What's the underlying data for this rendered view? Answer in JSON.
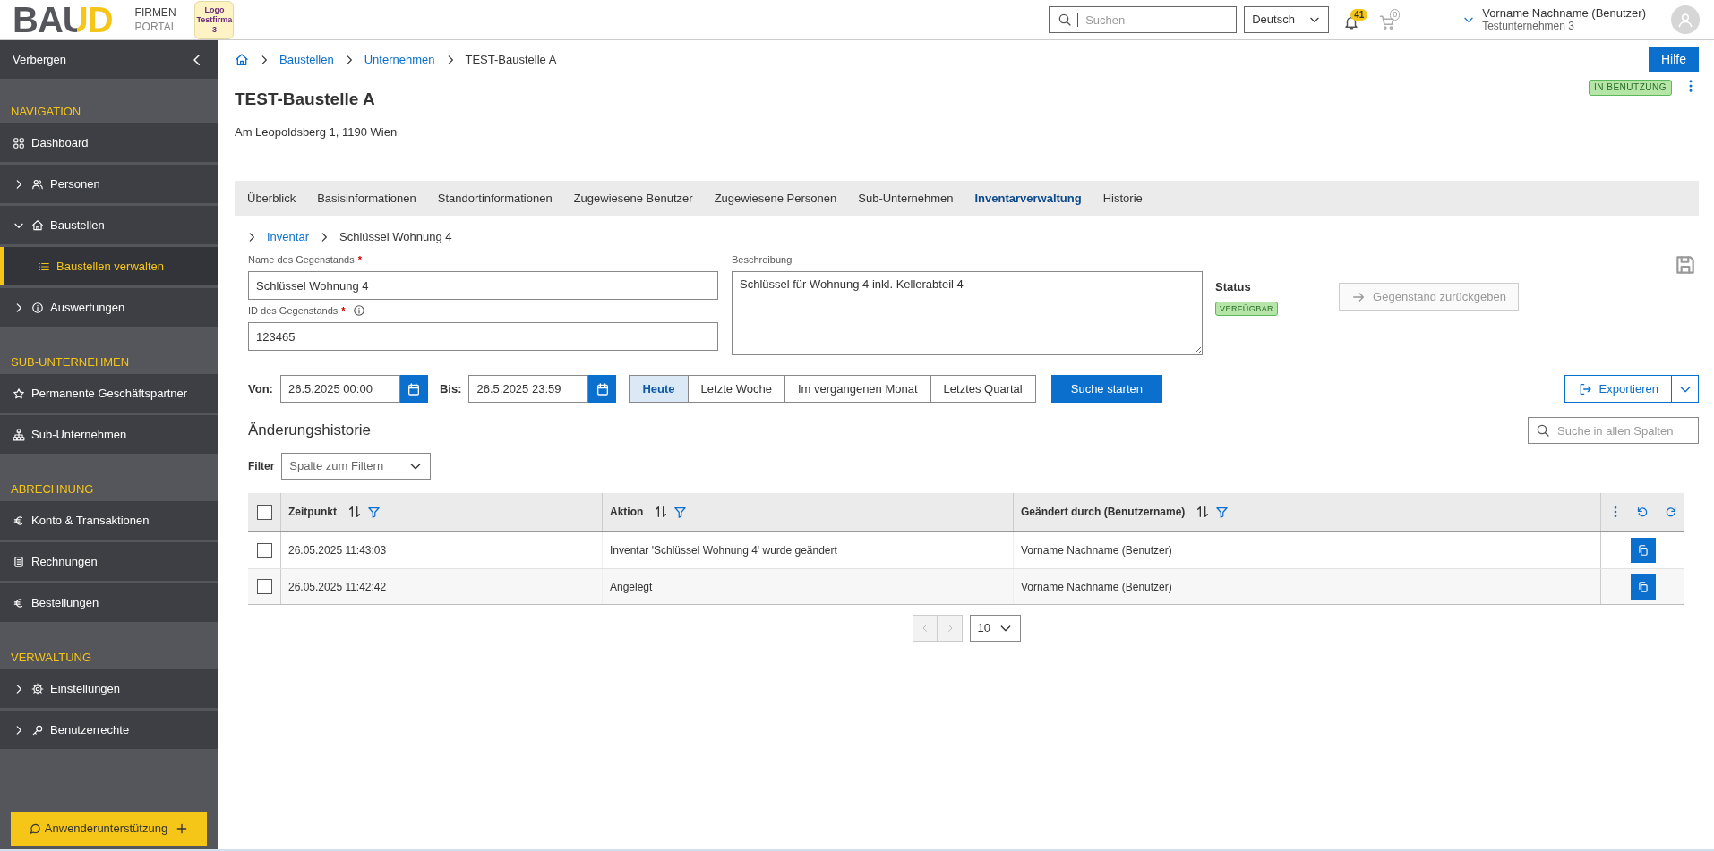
{
  "header": {
    "logo": "BAUD",
    "portal_line1": "FIRMEN",
    "portal_line2": "PORTAL",
    "company_logo": "Logo Testfirma 3",
    "search": {
      "placeholder": "Suchen"
    },
    "language": "Deutsch",
    "notifications": "41",
    "cart": "0",
    "user": {
      "name": "Vorname Nachname (Benutzer)",
      "company": "Testunternehmen 3"
    }
  },
  "sidebar": {
    "hide_label": "Verbergen",
    "sections": [
      {
        "title": "NAVIGATION",
        "items": [
          {
            "label": "Dashboard",
            "kind": "link",
            "selected": false
          },
          {
            "label": "Personen",
            "kind": "group",
            "expanded": false,
            "selected": false
          },
          {
            "label": "Baustellen",
            "kind": "group",
            "expanded": true,
            "selected": false,
            "children": [
              {
                "label": "Baustellen verwalten",
                "selected": true
              }
            ]
          },
          {
            "label": "Auswertungen",
            "kind": "group",
            "expanded": false,
            "selected": false
          }
        ]
      },
      {
        "title": "SUB-UNTERNEHMEN",
        "items": [
          {
            "label": "Permanente Geschäftspartner",
            "kind": "link",
            "selected": false
          },
          {
            "label": "Sub-Unternehmen",
            "kind": "link",
            "selected": false
          }
        ]
      },
      {
        "title": "ABRECHNUNG",
        "items": [
          {
            "label": "Konto & Transaktionen",
            "kind": "link",
            "selected": false
          },
          {
            "label": "Rechnungen",
            "kind": "link",
            "selected": false
          },
          {
            "label": "Bestellungen",
            "kind": "link",
            "selected": false
          }
        ]
      },
      {
        "title": "VERWALTUNG",
        "items": [
          {
            "label": "Einstellungen",
            "kind": "group",
            "expanded": false,
            "selected": false
          },
          {
            "label": "Benutzerrechte",
            "kind": "group",
            "expanded": false,
            "selected": false
          }
        ]
      }
    ],
    "support_button": "Anwenderunterstützung"
  },
  "breadcrumb": [
    "Baustellen",
    "Unternehmen",
    "TEST-Baustelle A"
  ],
  "help_button": "Hilfe",
  "page": {
    "title": "TEST-Baustelle A",
    "address": "Am Leopoldsberg 1, 1190 Wien",
    "status_badge": "IN BENUTZUNG"
  },
  "tabs": [
    {
      "label": "Überblick",
      "selected": false
    },
    {
      "label": "Basisinformationen",
      "selected": false
    },
    {
      "label": "Standortinformationen",
      "selected": false
    },
    {
      "label": "Zugewiesene Benutzer",
      "selected": false
    },
    {
      "label": "Zugewiesene Personen",
      "selected": false
    },
    {
      "label": "Sub-Unternehmen",
      "selected": false
    },
    {
      "label": "Inventarverwaltung",
      "selected": true
    },
    {
      "label": "Historie",
      "selected": false
    }
  ],
  "sub_breadcrumb": [
    "Inventar",
    "Schlüssel Wohnung 4"
  ],
  "form": {
    "name": {
      "label": "Name des Gegenstands",
      "required_mark": "*",
      "value": "Schlüssel Wohnung 4"
    },
    "id": {
      "label": "ID des Gegenstands",
      "required_mark": "*",
      "value": "123465"
    },
    "description": {
      "label": "Beschreibung",
      "value": "Schlüssel für Wohnung 4 inkl. Kellerabteil 4"
    },
    "status_label": "Status",
    "status_badge": "VERFÜGBAR",
    "return_button": {
      "label": "Gegenstand zurückgeben",
      "disabled": true
    }
  },
  "date_filter": {
    "from": {
      "label": "Von:",
      "value": "26.5.2025 00:00"
    },
    "to": {
      "label": "Bis:",
      "value": "26.5.2025 23:59"
    },
    "ranges": [
      {
        "label": "Heute",
        "selected": true
      },
      {
        "label": "Letzte Woche",
        "selected": false
      },
      {
        "label": "Im vergangenen Monat",
        "selected": false
      },
      {
        "label": "Letztes Quartal",
        "selected": false
      }
    ],
    "search_button": "Suche starten"
  },
  "export_button": "Exportieren",
  "history": {
    "title": "Änderungshistorie",
    "search": {
      "placeholder": "Suche in allen Spalten"
    },
    "filter_label": "Filter",
    "filter_select": {
      "placeholder": "Spalte zum Filtern"
    },
    "table": {
      "all_checked": false,
      "columns": [
        "Zeitpunkt",
        "Aktion",
        "Geändert durch (Benutzername)"
      ],
      "rows": [
        {
          "checked": false,
          "cells": [
            "26.05.2025 11:43:03",
            "Inventar 'Schlüssel Wohnung 4' wurde geändert",
            "Vorname Nachname (Benutzer)"
          ]
        },
        {
          "checked": false,
          "cells": [
            "26.05.2025 11:42:42",
            "Angelegt",
            "Vorname Nachname (Benutzer)"
          ]
        }
      ]
    },
    "pagination": {
      "prev_disabled": true,
      "next_disabled": true,
      "page_size": "10"
    }
  }
}
